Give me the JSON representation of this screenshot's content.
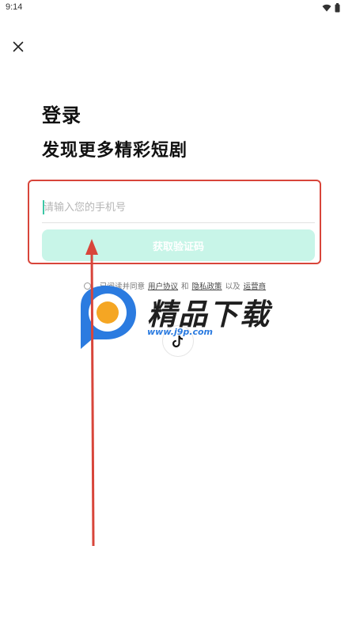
{
  "status_bar": {
    "time": "9:14",
    "icons": [
      "wifi-icon",
      "battery-icon"
    ]
  },
  "header": {
    "close_icon": "close-icon"
  },
  "login": {
    "title": "登录",
    "subtitle": "发现更多精彩短剧",
    "phone_placeholder": "请输入您的手机号",
    "code_button_label": "获取验证码"
  },
  "agreement": {
    "prefix": "已阅读并同意",
    "user_agreement": "用户协议",
    "and": "和",
    "privacy_policy": "隐私政策",
    "also": "以及",
    "carrier": "运营商"
  },
  "third_party": {
    "tiktok_icon": "tiktok-icon"
  },
  "watermark": {
    "brand": "精品下载",
    "url": "www.j9p.com"
  },
  "colors": {
    "accent": "#3cc7a6",
    "button_bg": "#c8f5e8",
    "annotation_red": "#d8453a",
    "watermark_blue": "#2b7be0",
    "watermark_orange": "#f5a623"
  }
}
